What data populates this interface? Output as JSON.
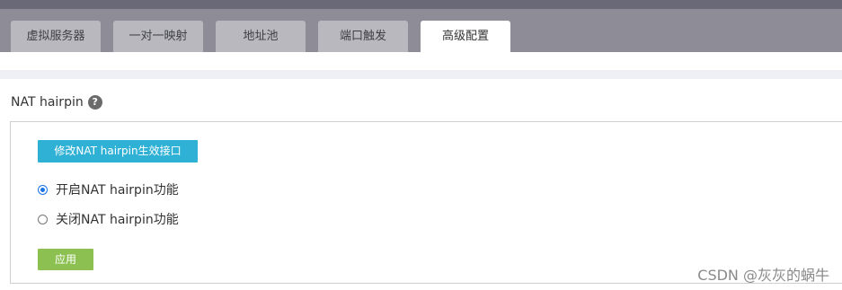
{
  "tabs": [
    {
      "label": "虚拟服务器"
    },
    {
      "label": "一对一映射"
    },
    {
      "label": "地址池"
    },
    {
      "label": "端口触发"
    },
    {
      "label": "高级配置"
    }
  ],
  "active_tab": "高级配置",
  "section": {
    "title": "NAT hairpin",
    "help_symbol": "?"
  },
  "modify_button": "修改NAT hairpin生效接口",
  "options": [
    {
      "label": "开启NAT hairpin功能",
      "selected": true
    },
    {
      "label": "关闭NAT hairpin功能",
      "selected": false
    }
  ],
  "apply_button": "应用",
  "watermark": "CSDN @灰灰的蜗牛",
  "colors": {
    "tab_bar": "#8e8c96",
    "tab_inactive": "#b9b8bf",
    "modify_button": "#2fb1d6",
    "apply_button": "#8cc152",
    "radio_selected": "#1a73e8"
  }
}
